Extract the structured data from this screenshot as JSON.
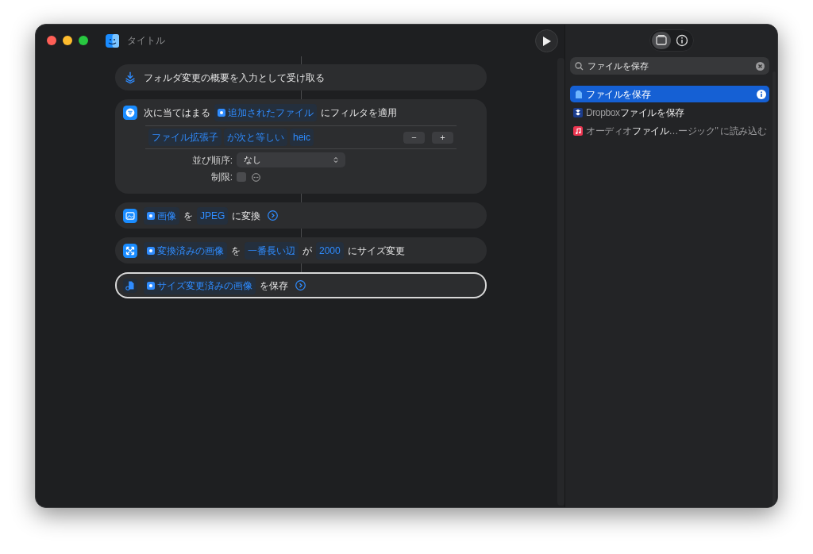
{
  "window": {
    "title": "タイトル"
  },
  "actions": [
    {
      "selected": false,
      "parts": [
        {
          "kind": "text",
          "text": "フォルダ変更の概要を入力として受け取る"
        }
      ],
      "has_options": false
    },
    {
      "selected": false,
      "parts": [
        {
          "kind": "text",
          "text": "次に当てはまる"
        },
        {
          "kind": "token",
          "text": "追加されたファイル",
          "has_icon": true
        },
        {
          "kind": "text",
          "text": "にフィルタを適用"
        }
      ],
      "has_options": false,
      "filter": {
        "conditions": [
          {
            "kind": "token",
            "text": "ファイル拡張子"
          },
          {
            "kind": "token",
            "text": "が次と等しい"
          },
          {
            "kind": "token",
            "text": "heic"
          }
        ],
        "remove_button": "−",
        "add_button": "+",
        "sort_label": "並び順序:",
        "sort_value": "なし",
        "limit_label": "制限:",
        "limit_checked": false
      }
    },
    {
      "selected": false,
      "parts": [
        {
          "kind": "token",
          "text": "画像",
          "has_icon": true
        },
        {
          "kind": "text",
          "text": "を"
        },
        {
          "kind": "token",
          "text": "JPEG",
          "has_icon": false
        },
        {
          "kind": "text",
          "text": "に変換"
        }
      ],
      "has_options": true
    },
    {
      "selected": false,
      "parts": [
        {
          "kind": "token",
          "text": "変換済みの画像",
          "has_icon": true
        },
        {
          "kind": "text",
          "text": "を"
        },
        {
          "kind": "token",
          "text": "一番長い辺",
          "has_icon": false
        },
        {
          "kind": "text",
          "text": "が"
        },
        {
          "kind": "token",
          "text": "2000",
          "has_icon": false
        },
        {
          "kind": "text",
          "text": "にサイズ変更"
        }
      ],
      "has_options": false
    },
    {
      "selected": true,
      "parts": [
        {
          "kind": "token",
          "text": "サイズ変更済みの画像",
          "has_icon": true
        },
        {
          "kind": "text",
          "text": "を保存"
        }
      ],
      "has_options": true
    }
  ],
  "sidebar": {
    "tabs": [
      {
        "kind": "library",
        "selected": true
      },
      {
        "kind": "info",
        "selected": false
      }
    ],
    "search": {
      "value": "ファイルを保存"
    },
    "results": [
      {
        "label": "ファイルを保存",
        "selected": true
      },
      {
        "label": "Dropbox**ファイルを保存**",
        "selected": false
      },
      {
        "label": "オーディオ**ファイル**…ージック\" に読み込む",
        "selected": false
      }
    ]
  }
}
